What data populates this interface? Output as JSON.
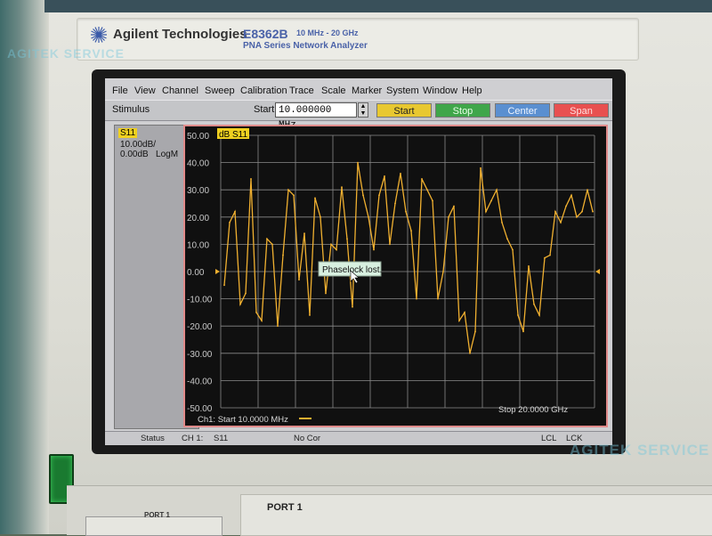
{
  "instrument": {
    "brand": "Agilent Technologies",
    "model": "E8362B",
    "range": "10 MHz - 20 GHz",
    "series": "PNA Series Network Analyzer"
  },
  "watermark": {
    "text": "AGITEK SERVICE"
  },
  "menubar": {
    "items": [
      "File",
      "View",
      "Channel",
      "Sweep",
      "Calibration",
      "Trace",
      "Scale",
      "Marker",
      "System",
      "Window",
      "Help"
    ]
  },
  "toolbar": {
    "stimulus_label": "Stimulus",
    "start_label": "Start",
    "start_value": "10.000000 MHz",
    "buttons": {
      "start": "Start",
      "stop": "Stop",
      "center": "Center",
      "span": "Span"
    }
  },
  "trace_panel": {
    "tag": "S11",
    "scale_line1": "10.00dB/",
    "scale_line2": "0.00dB",
    "format": "LogM"
  },
  "plot": {
    "tag": "dB S11",
    "y_ticks": [
      "50.00",
      "40.00",
      "30.00",
      "20.00",
      "10.00",
      "0.00",
      "-10.00",
      "-20.00",
      "-30.00",
      "-40.00",
      "-50.00"
    ],
    "start_footer": "Ch1: Start  10.0000 MHz",
    "stop_footer": "Stop  20.0000 GHz",
    "dialog": "Phaselock lost.",
    "trace_color": "#f0b030",
    "grid_color": "#8a8a8a"
  },
  "chart_data": {
    "type": "line",
    "title": "dB S11",
    "xlabel": "",
    "ylabel": "",
    "ylim": [
      -50,
      50
    ],
    "x_range_text": [
      "10.0000 MHz",
      "20.0000 GHz"
    ],
    "series": [
      {
        "name": "S11",
        "values": [
          -5,
          18,
          22,
          -12,
          -8,
          34,
          -15,
          -18,
          12,
          10,
          -20,
          6,
          30,
          28,
          -3,
          14,
          -16,
          27,
          20,
          -8,
          10,
          8,
          31,
          12,
          -13,
          40,
          28,
          20,
          8,
          28,
          35,
          10,
          25,
          36,
          22,
          15,
          -10,
          34,
          30,
          26,
          -10,
          0,
          20,
          24,
          -18,
          -15,
          -30,
          -22,
          38,
          22,
          26,
          30,
          18,
          12,
          8,
          -16,
          -22,
          2,
          -12,
          -16,
          5,
          6,
          22,
          18,
          24,
          28,
          20,
          22,
          30,
          22
        ]
      }
    ]
  },
  "status_bar": {
    "status": "Status",
    "channel": "CH 1:",
    "trace": "S11",
    "correction": "No Cor",
    "lcl": "LCL",
    "lck": "LCK"
  },
  "front_panel": {
    "port1": "PORT 1",
    "port1_small": "PORT 1"
  }
}
